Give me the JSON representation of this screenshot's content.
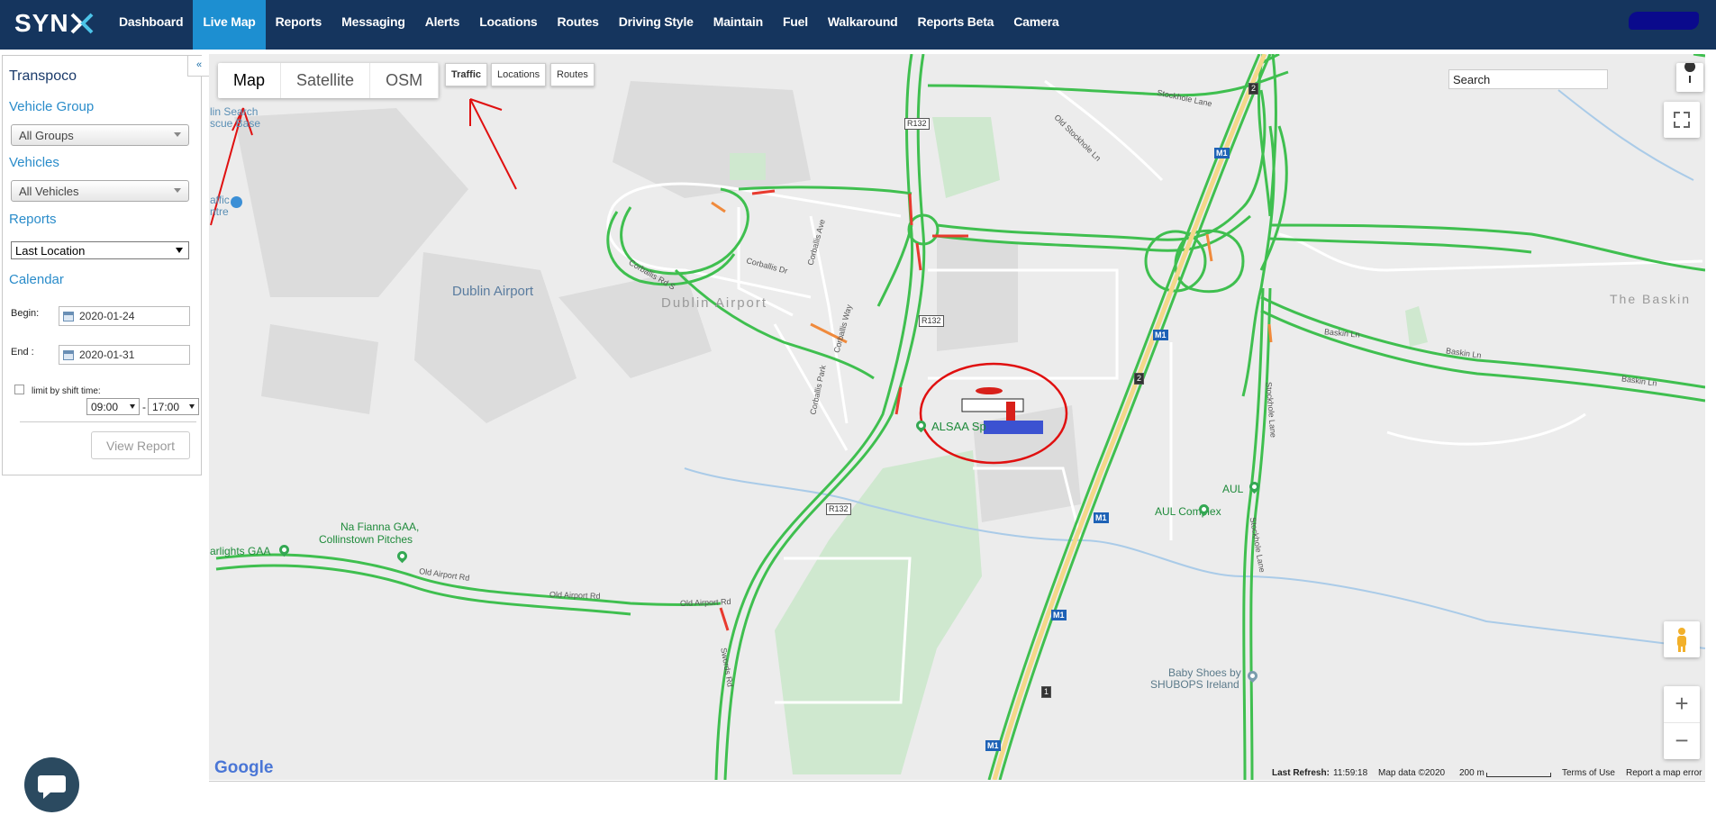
{
  "app": {
    "logo_text": "SYN"
  },
  "nav": {
    "items": [
      "Dashboard",
      "Live Map",
      "Reports",
      "Messaging",
      "Alerts",
      "Locations",
      "Routes",
      "Driving Style",
      "Maintain",
      "Fuel",
      "Walkaround",
      "Reports Beta",
      "Camera"
    ],
    "active": "Live Map"
  },
  "sidebar": {
    "collapse_icon": "«",
    "company": "Transpoco",
    "vehicle_group_label": "Vehicle Group",
    "vehicle_group_value": "All Groups",
    "vehicles_label": "Vehicles",
    "vehicles_value": "All Vehicles",
    "reports_label": "Reports",
    "reports_value": "Last Location",
    "calendar_label": "Calendar",
    "begin_label": "Begin:",
    "begin_value": "2020-01-24",
    "end_label": "End :",
    "end_value": "2020-01-31",
    "shift_label": "limit by shift time:",
    "shift_start": "09:00",
    "shift_sep": "-",
    "shift_end": "17:00",
    "view_report": "View Report"
  },
  "map": {
    "types": [
      "Map",
      "Satellite",
      "OSM"
    ],
    "selected_type": "Map",
    "layers": [
      "Traffic",
      "Locations",
      "Routes"
    ],
    "search_placeholder": "Search",
    "zoom_in": "+",
    "zoom_out": "−",
    "labels": {
      "dublin_airport": "Dublin Airport",
      "dublin_airport_grey": "Dublin Airport",
      "the_baskin": "The Baskin",
      "alsaa": "ALSAA Sp",
      "aul": "AUL",
      "aul_complex": "AUL Complex",
      "na_fianna_1": "Na Fianna GAA,",
      "na_fianna_2": "Collinstown Pitches",
      "starlights": "arlights GAA",
      "baby_shoes_1": "Baby Shoes by",
      "baby_shoes_2": "SHUBOPS Ireland",
      "search_rescue_1": "lin Search",
      "search_rescue_2": "scue Base",
      "traffic_centre_1": "affic",
      "traffic_centre_2": "ntre"
    },
    "roads": {
      "stockhole_lane": "Stockhole Lane",
      "old_stockhole": "Old Stockhole Ln",
      "baskin_ln_1": "Baskin Ln",
      "baskin_ln_2": "Baskin Ln",
      "baskin_ln_3": "Baskin Ln",
      "stockhole_lane_v": "Stockhole Lane",
      "stockhole_lane_v2": "Stockhole Lane",
      "corballis_rd": "Corballis Rd S",
      "corballis_dr": "Corballis Dr",
      "corballis_ave": "Corballis Ave",
      "corballis_way": "Corballis Way",
      "corballis_park": "Corballis Park",
      "old_airport_rd_1": "Old Airport Rd",
      "old_airport_rd_2": "Old Airport Rd",
      "old_airport_rd_3": "Old Airport Rd",
      "swords_rd": "Swords Rd",
      "r132_a": "R132",
      "r132_b": "R132",
      "r132_c": "R132",
      "m1_a": "M1",
      "m1_b": "M1",
      "m1_c": "M1",
      "m1_d": "M1",
      "m1_e": "M1",
      "exit_2a": "2",
      "exit_2b": "2",
      "exit_1": "1"
    },
    "footer": {
      "last_refresh_label": "Last Refresh:",
      "last_refresh_time": "11:59:18",
      "map_data": "Map data ©2020",
      "scale": "200 m",
      "terms": "Terms of Use",
      "report_error": "Report a map error",
      "google": "Google"
    }
  },
  "colors": {
    "nav_bg": "#15355e",
    "nav_active": "#1d8fd1",
    "accent_blue": "#2a8cca",
    "traffic_green": "#3fbf4f",
    "traffic_red": "#e83a2e",
    "annotation_red": "#e01010"
  },
  "icons": {
    "pegman": "pegman-icon",
    "fullscreen": "fullscreen-icon",
    "pin": "pin-icon",
    "chat": "chat-icon",
    "calendar": "calendar-icon",
    "vehicle": "vehicle-icon"
  }
}
